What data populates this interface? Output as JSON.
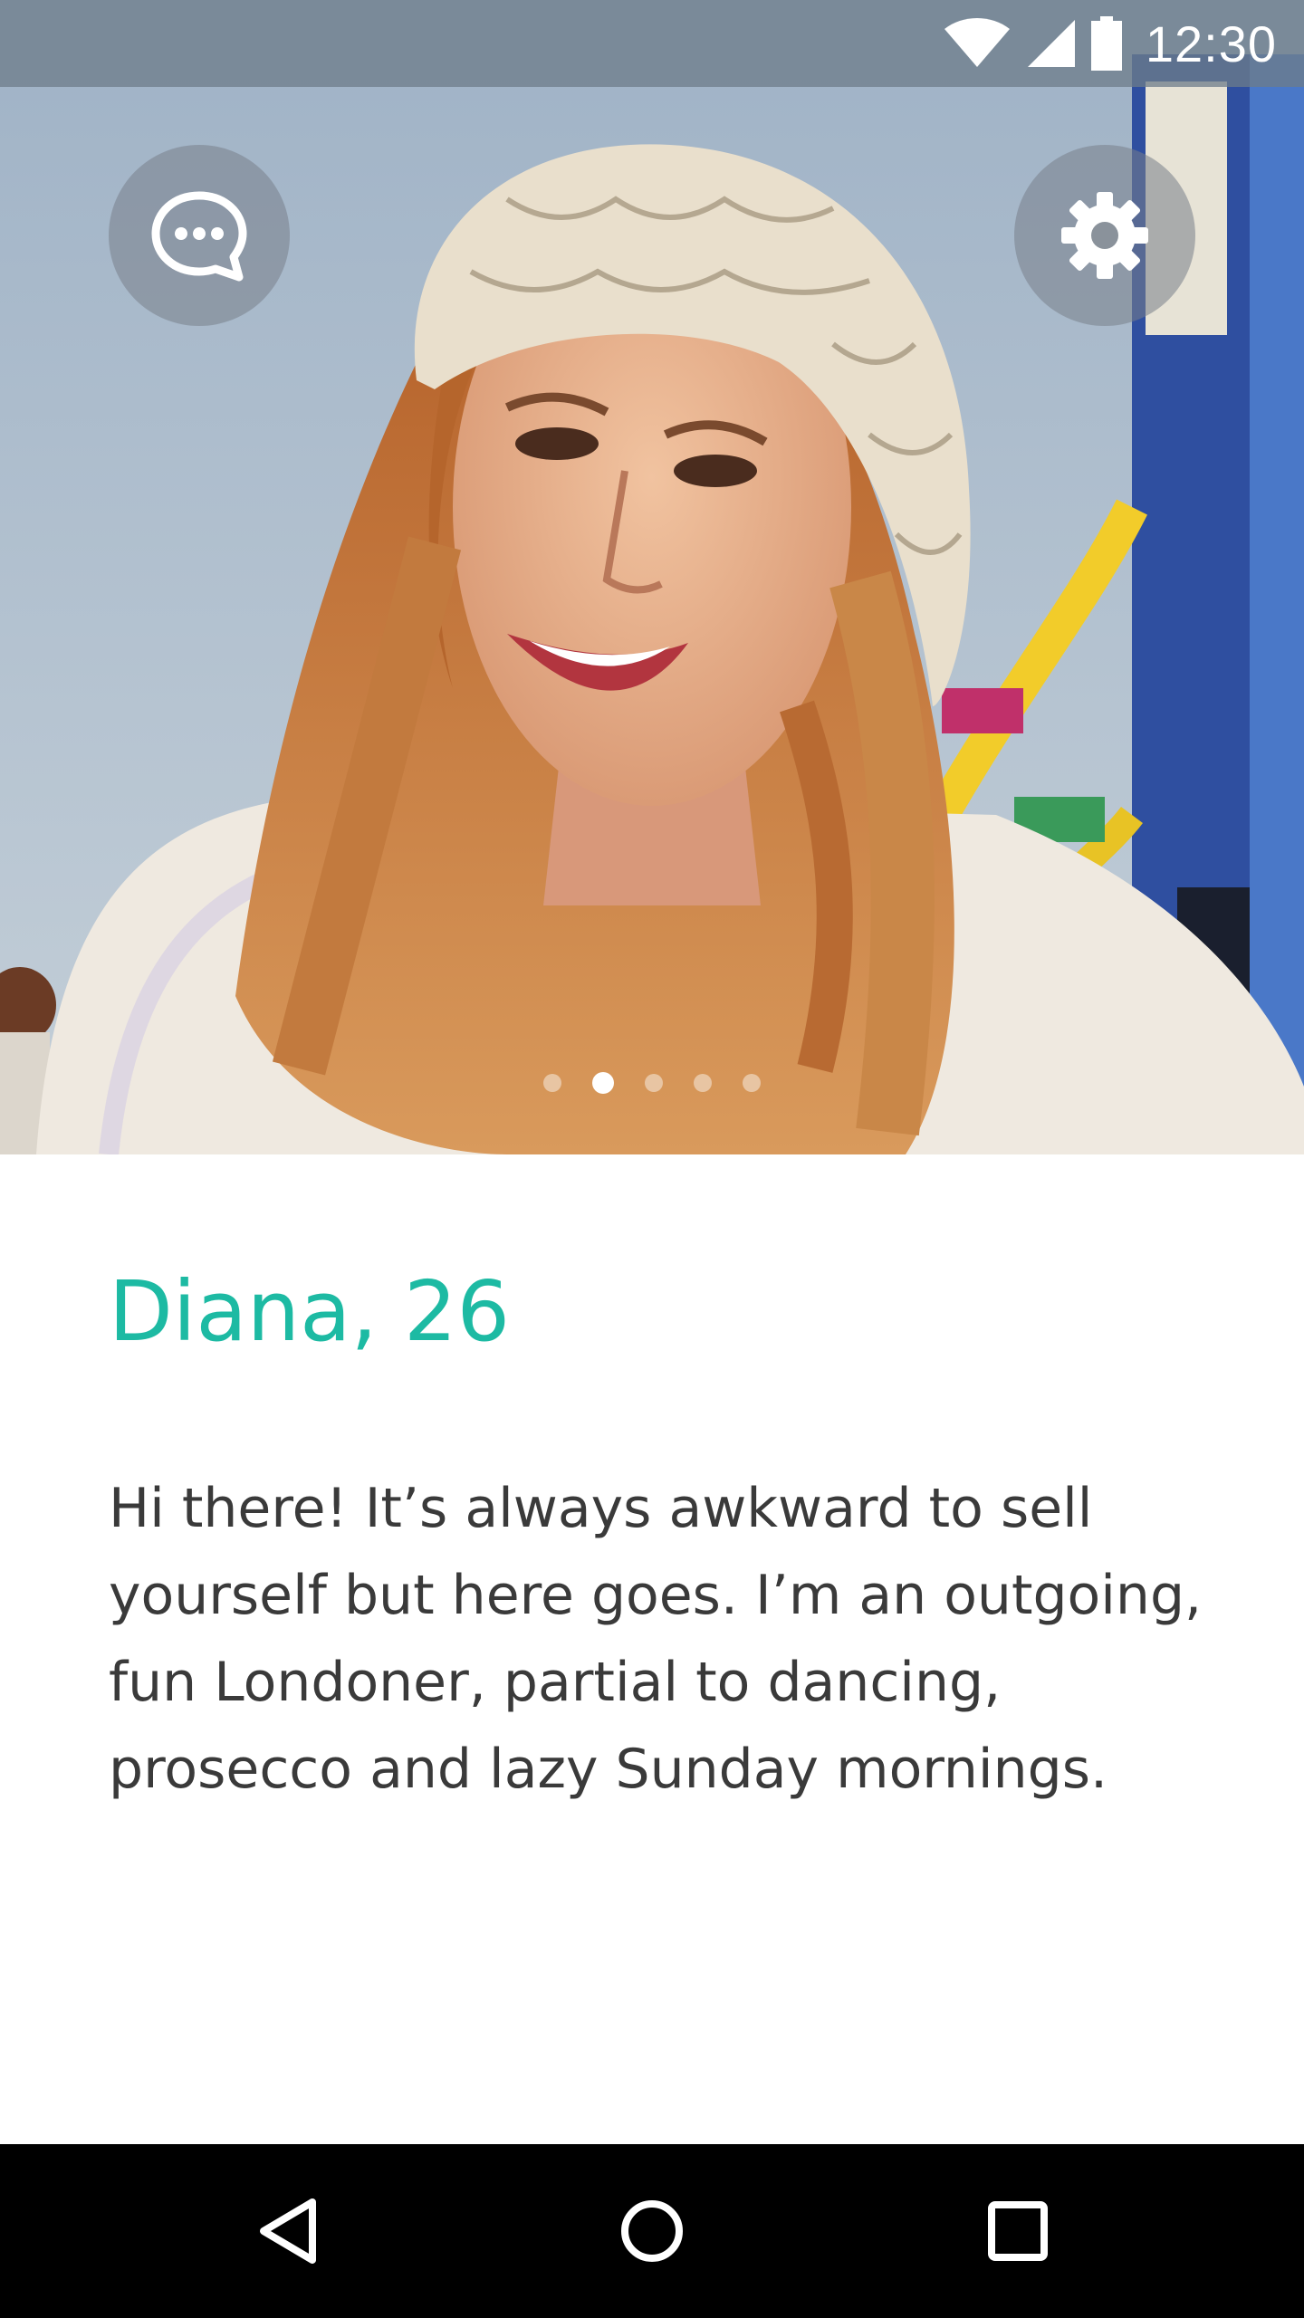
{
  "status_bar": {
    "time": "12:30",
    "icons": [
      "wifi-icon",
      "cell-signal-icon",
      "battery-icon"
    ]
  },
  "photo": {
    "description_icon": "profile-photo",
    "page_count": 5,
    "active_page": 2
  },
  "actions": {
    "chat_icon": "chat-bubble-icon",
    "settings_icon": "gear-icon"
  },
  "profile": {
    "name_age": "Diana, 26",
    "bio_lines": [
      "Hi there! It’s always awkward to sell",
      "yourself but here goes. I’m an outgoing,",
      "fun Londoner, partial to dancing,",
      "prosecco and lazy Sunday mornings."
    ]
  },
  "nav_bar": {
    "buttons": [
      "back-icon",
      "home-icon",
      "recents-icon"
    ]
  },
  "colors": {
    "accent": "#1dbaa3",
    "body_text": "#3a3a3a",
    "status_bar": "#6e7c8a",
    "nav_bar": "#000000"
  }
}
